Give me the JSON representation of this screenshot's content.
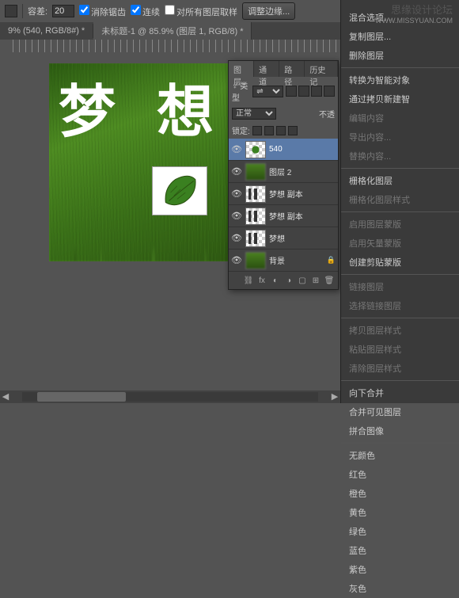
{
  "toolbar": {
    "tolerance_label": "容差:",
    "tolerance_value": "20",
    "antialias_label": "消除锯齿",
    "contiguous_label": "连续",
    "all_layers_label": "对所有图层取样",
    "refine_edge_label": "调整边缘..."
  },
  "tabs": {
    "tab1": "9% (540, RGB/8#) *",
    "tab2": "未标题-1 @ 85.9% (图层 1, RGB/8) *"
  },
  "watermark": {
    "cn": "思缘设计论坛",
    "en": "WWW.MISSYUAN.COM"
  },
  "canvas_text": "梦 想",
  "layers_panel": {
    "tabs": {
      "t1": "图层",
      "t2": "通道",
      "t3": "路径",
      "t4": "历史记"
    },
    "kind_label": "♀ 类型",
    "blend_mode": "正常",
    "opacity_label": "不透",
    "lock_label": "锁定:",
    "layers": [
      {
        "name": "540",
        "type": "img"
      },
      {
        "name": "图层 2",
        "type": "grass"
      },
      {
        "name": "梦想 副本",
        "type": "text"
      },
      {
        "name": "梦想 副本",
        "type": "text"
      },
      {
        "name": "梦想",
        "type": "text"
      },
      {
        "name": "背景",
        "type": "bg"
      }
    ]
  },
  "context_menu": {
    "items": [
      {
        "t": "混合选项...",
        "d": false
      },
      {
        "t": "复制图层...",
        "d": false
      },
      {
        "t": "删除图层",
        "d": false
      },
      {
        "sep": true
      },
      {
        "t": "转换为智能对象",
        "d": false
      },
      {
        "t": "通过拷贝新建智",
        "d": false
      },
      {
        "t": "编辑内容",
        "d": true
      },
      {
        "t": "导出内容...",
        "d": true
      },
      {
        "t": "替换内容...",
        "d": true
      },
      {
        "sep": true
      },
      {
        "t": "栅格化图层",
        "d": false
      },
      {
        "t": "栅格化图层样式",
        "d": true
      },
      {
        "sep": true
      },
      {
        "t": "启用图层蒙版",
        "d": true
      },
      {
        "t": "启用矢量蒙版",
        "d": true
      },
      {
        "t": "创建剪贴蒙版",
        "d": false
      },
      {
        "sep": true
      },
      {
        "t": "链接图层",
        "d": true
      },
      {
        "t": "选择链接图层",
        "d": true
      },
      {
        "sep": true
      },
      {
        "t": "拷贝图层样式",
        "d": true
      },
      {
        "t": "粘贴图层样式",
        "d": true
      },
      {
        "t": "清除图层样式",
        "d": true
      },
      {
        "sep": true
      },
      {
        "t": "向下合并",
        "d": false
      },
      {
        "t": "合并可见图层",
        "d": false
      },
      {
        "t": "拼合图像",
        "d": false
      },
      {
        "sep": true
      },
      {
        "t": "无颜色",
        "d": false
      },
      {
        "t": "红色",
        "d": false
      },
      {
        "t": "橙色",
        "d": false
      },
      {
        "t": "黄色",
        "d": false
      },
      {
        "t": "绿色",
        "d": false
      },
      {
        "t": "蓝色",
        "d": false
      },
      {
        "t": "紫色",
        "d": false
      },
      {
        "t": "灰色",
        "d": false
      }
    ]
  }
}
